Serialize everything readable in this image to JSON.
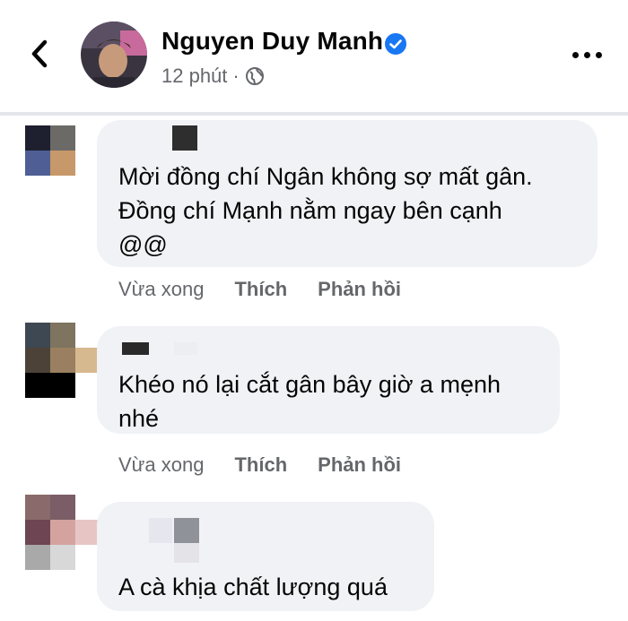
{
  "header": {
    "author_name": "Nguyen Duy Manh",
    "time": "12 phút",
    "separator": "·",
    "icons": {
      "back": "chevron-left-icon",
      "verified": "verified-badge-icon",
      "privacy": "globe-icon",
      "more": "more-horizontal-icon"
    },
    "accent_color": "#1877f2"
  },
  "comments": [
    {
      "text_lines": [
        "Mời đồng chí Ngân không sợ mất gân.",
        "Đồng chí Mạnh nằm ngay bên cạnh",
        "@@"
      ],
      "time": "Vừa xong",
      "like_label": "Thích",
      "reply_label": "Phản hồi"
    },
    {
      "text_lines": [
        "Khéo nó lại cắt gân bây giờ a mẹnh",
        "nhé"
      ],
      "time": "Vừa xong",
      "like_label": "Thích",
      "reply_label": "Phản hồi"
    },
    {
      "text_lines": [
        "A cà khịa chất lượng quá"
      ]
    }
  ]
}
